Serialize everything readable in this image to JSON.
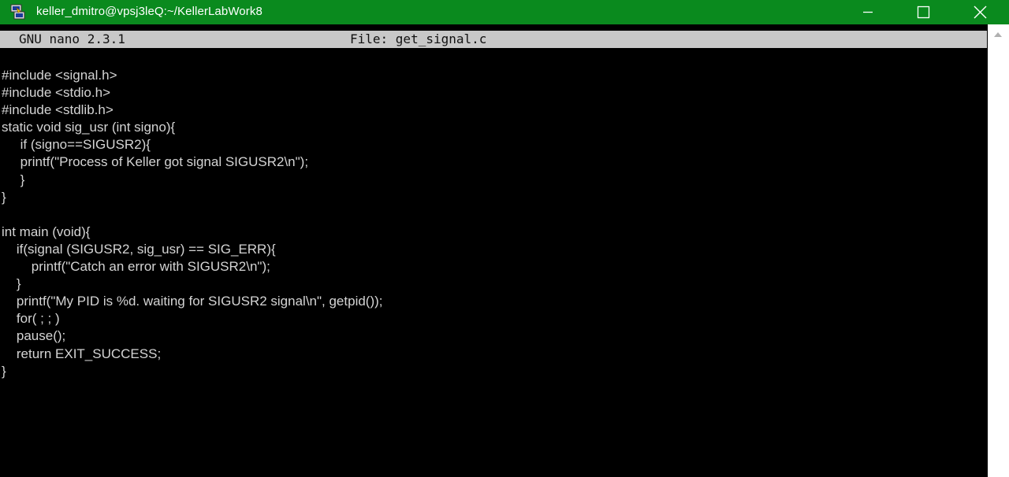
{
  "window": {
    "title": "keller_dmitro@vpsj3leQ:~/KellerLabWork8",
    "icon": "putty-icon",
    "title_bar_color": "#0a8a1e",
    "controls": [
      "minimize-icon",
      "maximize-icon",
      "close-icon"
    ]
  },
  "nano": {
    "version": "GNU nano 2.3.1",
    "file_label": "File: get_signal.c",
    "header_bg": "#c8c8c8"
  },
  "code": {
    "lines": [
      "#include <signal.h>",
      "#include <stdio.h>",
      "#include <stdlib.h>",
      "static void sig_usr (int signo){",
      "     if (signo==SIGUSR2){",
      "     printf(\"Process of Keller got signal SIGUSR2\\n\");",
      "     }",
      "}",
      "",
      "int main (void){",
      "    if(signal (SIGUSR2, sig_usr) == SIG_ERR){",
      "        printf(\"Catch an error with SIGUSR2\\n\");",
      "    }",
      "    printf(\"My PID is %d. waiting for SIGUSR2 signal\\n\", getpid());",
      "    for( ; ; )",
      "    pause();",
      "    return EXIT_SUCCESS;",
      "}"
    ]
  }
}
